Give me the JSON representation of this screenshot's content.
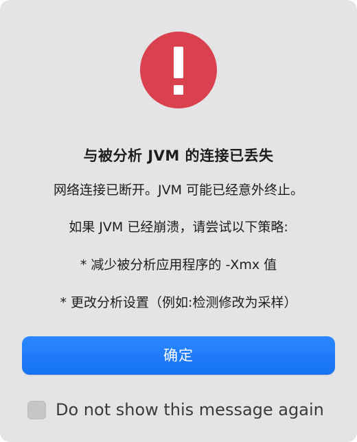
{
  "dialog": {
    "icon": "exclamation-alert-icon",
    "accent_color": "#d9414f",
    "title": "与被分析 JVM 的连接已丢失",
    "messages": [
      "网络连接已断开。JVM 可能已经意外终止。",
      "如果 JVM 已经崩溃，请尝试以下策略:",
      "* 减少被分析应用程序的 -Xmx 值",
      "* 更改分析设置（例如:检测修改为采样）"
    ],
    "ok_button_label": "确定",
    "ok_button_color": "#1f7bff",
    "suppress_checkbox": {
      "checked": false,
      "label": "Do not show this message again"
    }
  }
}
